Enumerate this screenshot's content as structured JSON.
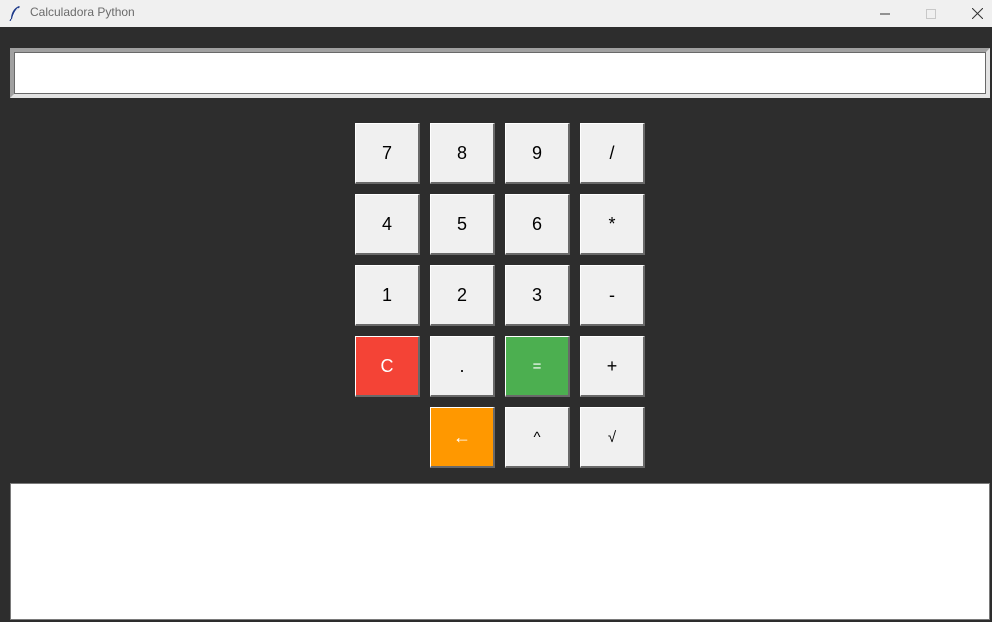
{
  "window": {
    "title": "Calculadora Python",
    "app_icon": "feather-icon",
    "controls": {
      "minimize_icon": "minimize-icon",
      "maximize_icon": "maximize-icon",
      "close_icon": "close-icon"
    }
  },
  "display": {
    "value": ""
  },
  "keypad": {
    "rows": [
      [
        "7",
        "8",
        "9",
        "/"
      ],
      [
        "4",
        "5",
        "6",
        "*"
      ],
      [
        "1",
        "2",
        "3",
        "-"
      ],
      [
        "C",
        ".",
        "=",
        "+"
      ],
      [
        "←",
        "^",
        "√"
      ]
    ]
  },
  "history": {
    "text": ""
  },
  "colors": {
    "background": "#2d2d2d",
    "clear_button": "#f44336",
    "equals_button": "#4caf50",
    "backspace_button": "#ff9800",
    "default_button": "#f0f0f0"
  }
}
